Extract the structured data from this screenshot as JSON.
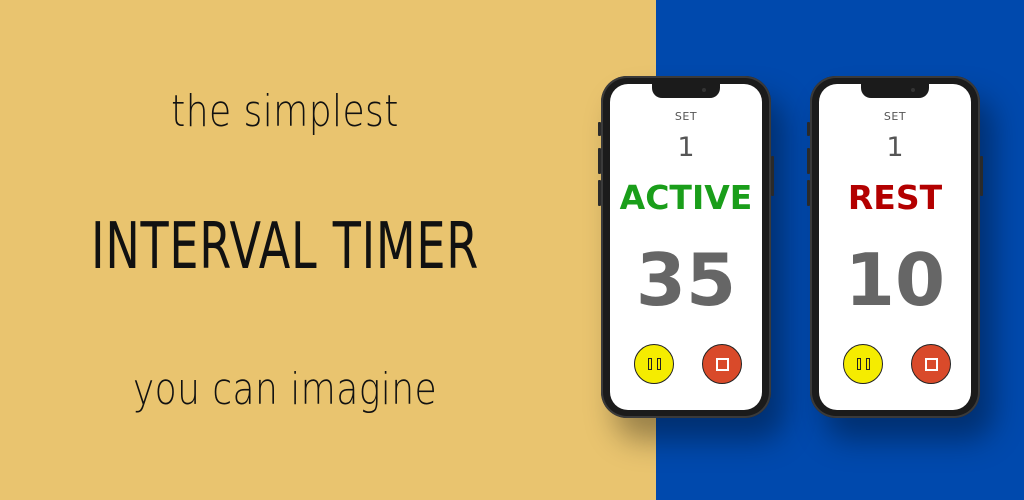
{
  "colors": {
    "left_background": "#e9c46f",
    "right_background": "#0049ad",
    "active": "#1a9e1a",
    "rest": "#b30000",
    "pause_button": "#f5ec00",
    "stop_button": "#d94a2a"
  },
  "tagline": {
    "top": "the simplest",
    "main": "INTERVAL TIMER",
    "bottom": "you can imagine"
  },
  "phones": [
    {
      "set_label": "SET",
      "set_number": "1",
      "state": "ACTIVE",
      "countdown": "35",
      "pause_icon": "pause-icon",
      "stop_icon": "stop-icon"
    },
    {
      "set_label": "SET",
      "set_number": "1",
      "state": "REST",
      "countdown": "10",
      "pause_icon": "pause-icon",
      "stop_icon": "stop-icon"
    }
  ]
}
